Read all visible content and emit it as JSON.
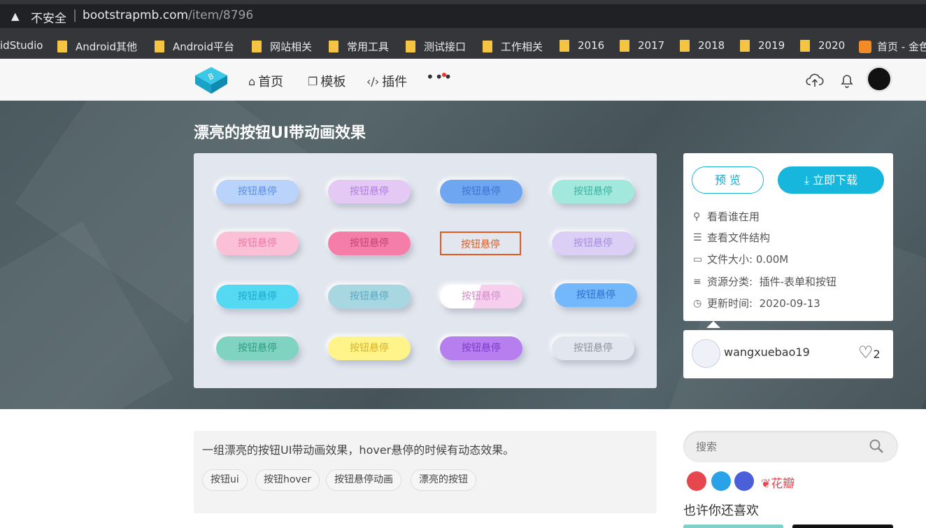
{
  "browser": {
    "insecure_label": "不安全",
    "separator": "|",
    "host": "bootstrapmb.com",
    "path": "/item/8796",
    "bookmarks": [
      {
        "label": "idStudio"
      },
      {
        "label": "Android其他"
      },
      {
        "label": "Android平台"
      },
      {
        "label": "网站相关"
      },
      {
        "label": "常用工具"
      },
      {
        "label": "测试接口"
      },
      {
        "label": "工作相关"
      },
      {
        "label": "2016"
      },
      {
        "label": "2017"
      },
      {
        "label": "2018"
      },
      {
        "label": "2019"
      },
      {
        "label": "2020"
      },
      {
        "label": "首页 - 金色"
      }
    ]
  },
  "header": {
    "nav": [
      {
        "label": "首页",
        "icon": "home-icon"
      },
      {
        "label": "模板",
        "icon": "template-icon"
      },
      {
        "label": "插件",
        "icon": "code-icon"
      }
    ],
    "more": "•••"
  },
  "hero": {
    "title": "漂亮的按钮UI带动画效果",
    "demo_label": "按钮悬停",
    "demo_buttons": [
      {
        "bg": "#b9d3fb",
        "fg": "#5a8fe6"
      },
      {
        "bg": "#e4c9f5",
        "fg": "#b07ee0"
      },
      {
        "bg": "#6ea6f2",
        "fg": "#3f73d0"
      },
      {
        "bg": "#a2e8dd",
        "fg": "#3bb3a1"
      },
      {
        "bg": "#fbbfd6",
        "fg": "#ec79a6"
      },
      {
        "bg": "#f47ea7",
        "fg": "#c64474"
      },
      {
        "bg": "#e2e6ee",
        "fg": "#e55b1e"
      },
      {
        "bg": "#dbcff5",
        "fg": "#a88ce0"
      },
      {
        "bg": "#55d9f2",
        "fg": "#1aa9cc"
      },
      {
        "bg": "#a8d6e1",
        "fg": "#5aaac2"
      },
      {
        "bg": "#f6cfee",
        "fg": "#d18cc6"
      },
      {
        "bg": "#72b8fa",
        "fg": "#2f6fd0"
      },
      {
        "bg": "#7fd3c0",
        "fg": "#2f9a85"
      },
      {
        "bg": "#fff48a",
        "fg": "#d8b22a"
      },
      {
        "bg": "#b77ef0",
        "fg": "#7a3cc9"
      },
      {
        "bg": "#e2e6ee",
        "fg": "#8f949c"
      }
    ]
  },
  "panel": {
    "preview_label": "预 览",
    "download_label": "立即下载",
    "rows": [
      {
        "icon": "user-list-icon",
        "label": "看看谁在用",
        "value": ""
      },
      {
        "icon": "structure-icon",
        "label": "查看文件结构",
        "value": ""
      },
      {
        "icon": "file-size-icon",
        "label": "文件大小:",
        "value": "0.00M"
      },
      {
        "icon": "category-icon",
        "label": "资源分类:",
        "value": "插件-表单和按钮"
      },
      {
        "icon": "clock-icon",
        "label": "更新时间:",
        "value": "2020-09-13"
      }
    ],
    "author": "wangxuebao19",
    "likes": "2"
  },
  "content": {
    "description": "一组漂亮的按钮UI带动画效果，hover悬停的时候有动态效果。",
    "tags": [
      "按钮ui",
      "按钮hover",
      "按钮悬停动画",
      "漂亮的按钮"
    ]
  },
  "sidebar": {
    "search_placeholder": "搜索",
    "share": [
      {
        "icon": "weibo-icon",
        "color": "#e6474f"
      },
      {
        "icon": "qq-icon",
        "color": "#2aa2e8"
      },
      {
        "icon": "baidu-icon",
        "color": "#4a5fd8"
      }
    ],
    "huaban_label": "花瓣",
    "maylike_label": "也许你还喜欢"
  }
}
